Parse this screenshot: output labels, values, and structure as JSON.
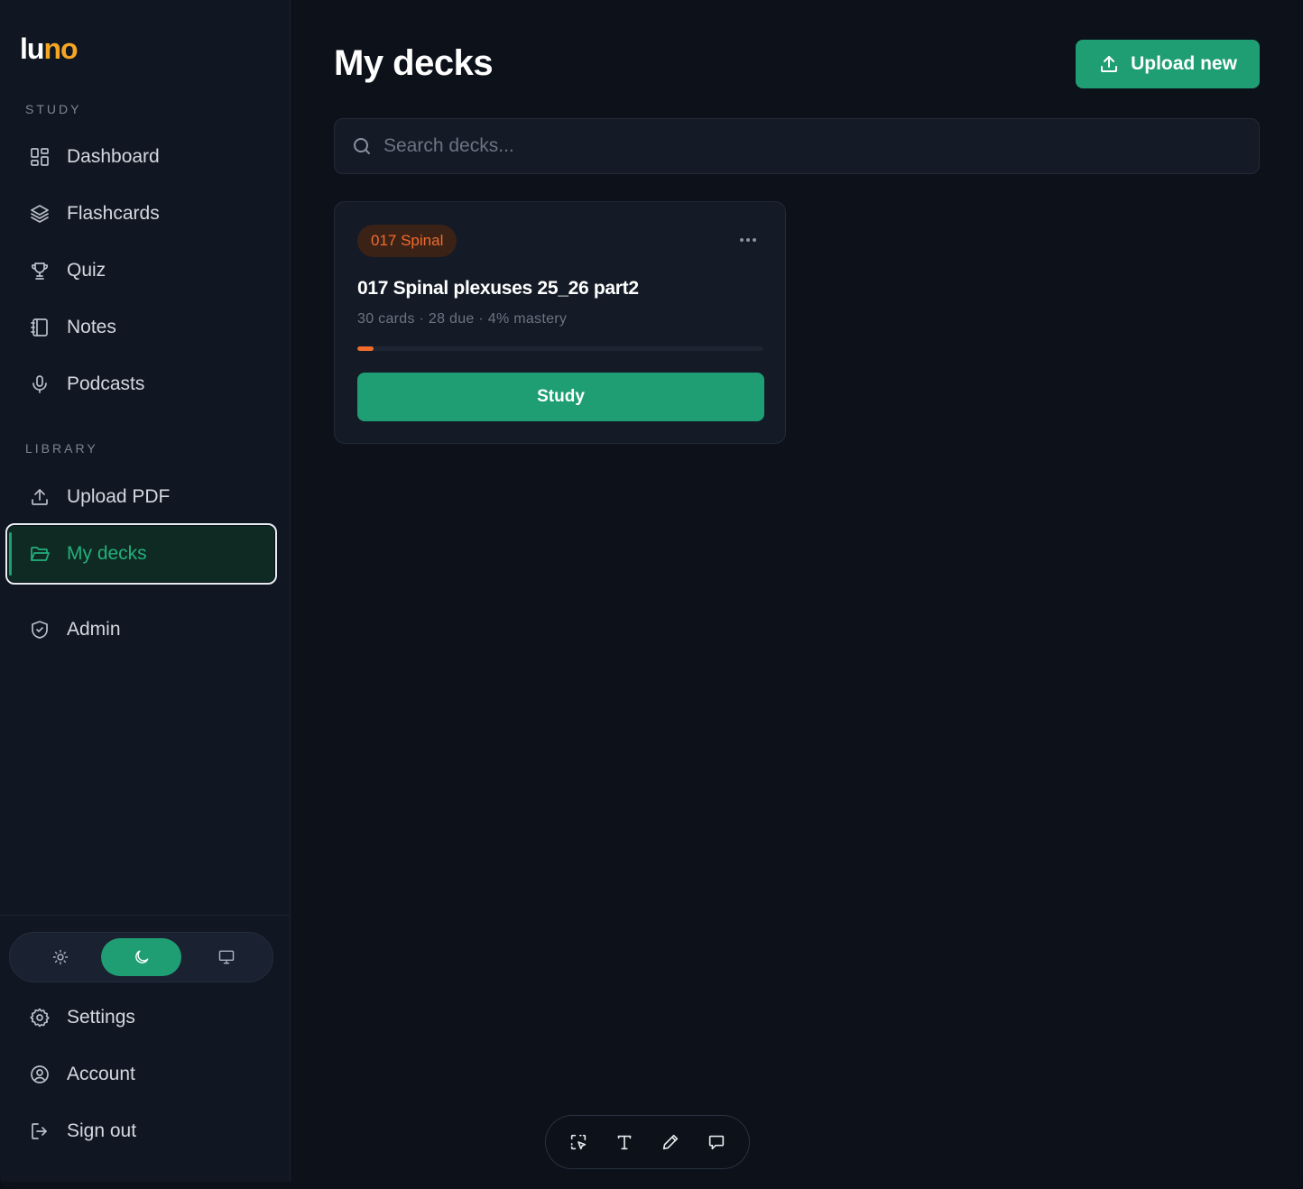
{
  "logo": {
    "part1": "lu",
    "part2": "no"
  },
  "sidebar": {
    "study_label": "STUDY",
    "study_items": [
      {
        "label": "Dashboard",
        "icon": "dashboard-icon"
      },
      {
        "label": "Flashcards",
        "icon": "layers-icon"
      },
      {
        "label": "Quiz",
        "icon": "trophy-icon"
      },
      {
        "label": "Notes",
        "icon": "notebook-icon"
      },
      {
        "label": "Podcasts",
        "icon": "microphone-icon"
      }
    ],
    "library_label": "LIBRARY",
    "library_items": [
      {
        "label": "Upload PDF",
        "icon": "upload-icon"
      },
      {
        "label": "My decks",
        "icon": "folder-open-icon",
        "active": true
      }
    ],
    "admin_item": {
      "label": "Admin",
      "icon": "shield-icon"
    },
    "theme": {
      "options": [
        "light",
        "dark",
        "system"
      ],
      "selected": "dark"
    },
    "bottom_items": [
      {
        "label": "Settings",
        "icon": "gear-icon"
      },
      {
        "label": "Account",
        "icon": "user-circle-icon"
      },
      {
        "label": "Sign out",
        "icon": "sign-out-icon"
      }
    ]
  },
  "main": {
    "title": "My decks",
    "upload_button": "Upload new",
    "search": {
      "placeholder": "Search decks...",
      "value": ""
    },
    "decks": [
      {
        "tag": "017 Spinal",
        "title": "017 Spinal plexuses 25_26 part2",
        "meta": "30 cards · 28 due · 4% mastery",
        "mastery_percent": 4,
        "study_label": "Study"
      }
    ]
  },
  "toolbar": {
    "tools": [
      "select-icon",
      "text-icon",
      "pencil-icon",
      "comment-icon"
    ]
  },
  "colors": {
    "accent": "#1f9e73",
    "tag": "#f26b2c",
    "logo_accent": "#f5a524",
    "background": "#0c111a",
    "sidebar": "#111722"
  }
}
